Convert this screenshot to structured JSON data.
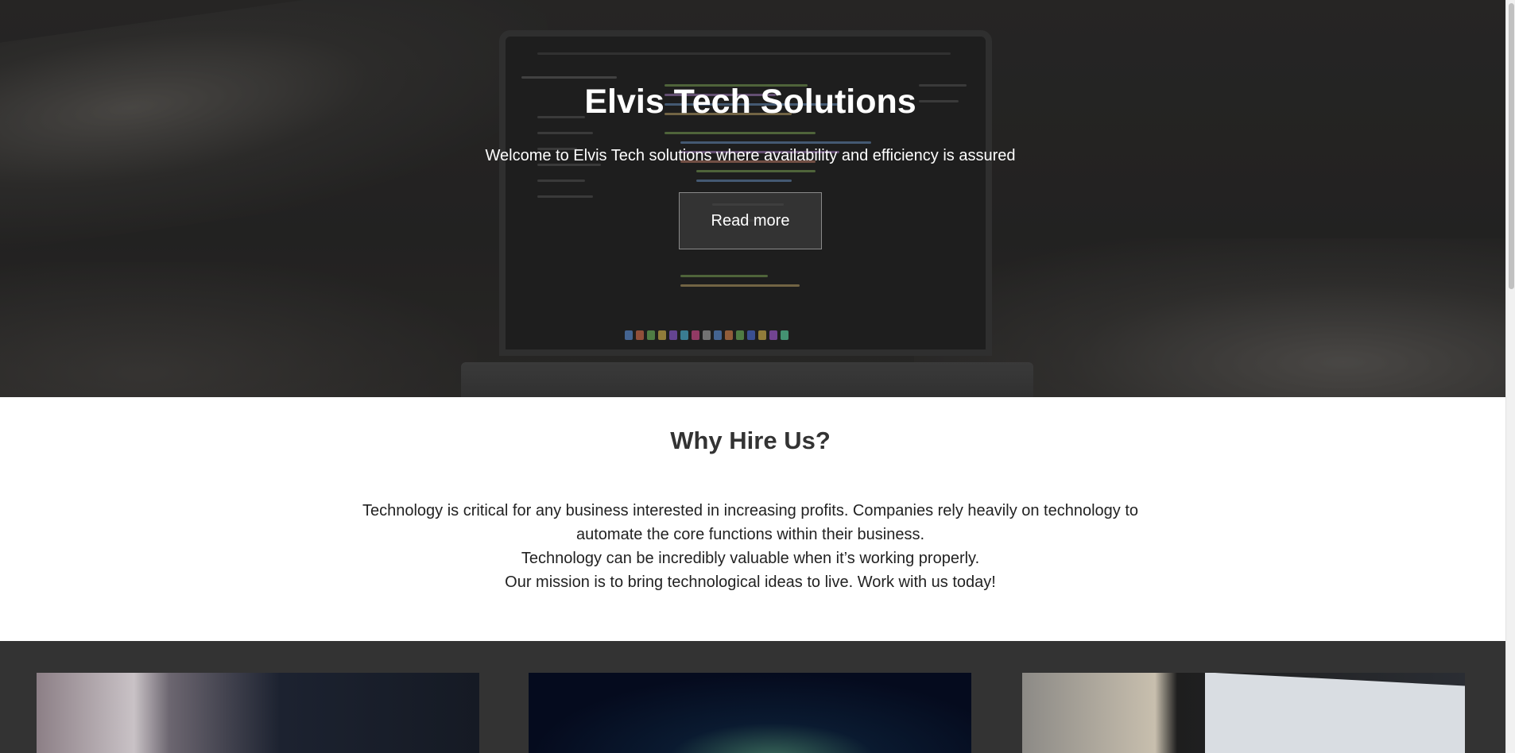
{
  "hero": {
    "title": "Elvis Tech Solutions",
    "subtitle": "Welcome to Elvis Tech solutions where availability and efficiency is assured",
    "cta_label": "Read more"
  },
  "why": {
    "title": "Why Hire Us?",
    "lines": [
      "Technology is critical for any business interested in increasing profits. Companies rely heavily on technology to automate the core functions within their business.",
      "Technology can be incredibly valuable when it’s working properly.",
      "Our mission is to bring technological ideas to live. Work with us today!"
    ]
  },
  "gallery": {
    "images": [
      "code-editor-photo",
      "dark-screen-photo",
      "spreadsheet-laptop-photo"
    ]
  },
  "colors": {
    "hero_text": "#ffffff",
    "heading": "#333333",
    "gallery_bg": "#333333"
  }
}
